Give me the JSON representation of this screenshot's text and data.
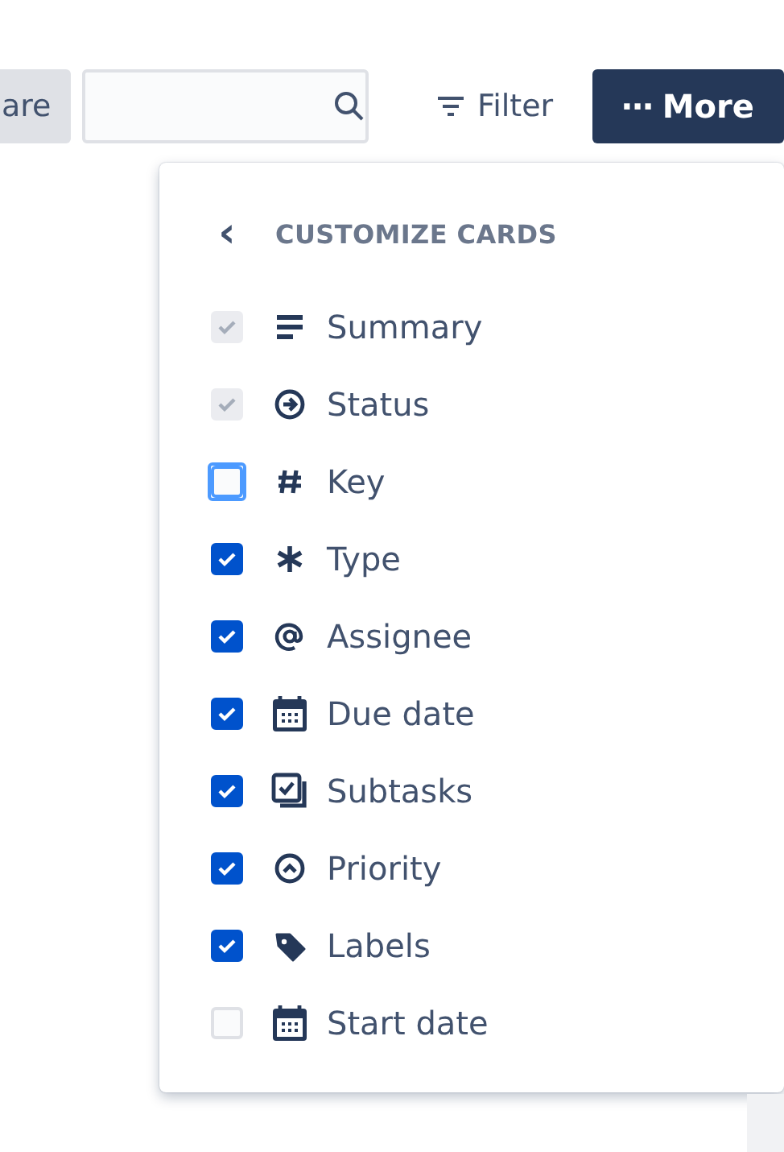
{
  "toolbar": {
    "share_button": "are",
    "filter_button": "Filter",
    "more_button": {
      "icon_text": "···",
      "label": "More"
    }
  },
  "dropdown": {
    "back": "‹",
    "title": "CUSTOMIZE CARDS",
    "items": [
      {
        "label": "Summary",
        "checked": true,
        "disabled": true,
        "focused": false
      },
      {
        "label": "Status",
        "checked": true,
        "disabled": true,
        "focused": false
      },
      {
        "label": "Key",
        "checked": false,
        "disabled": false,
        "focused": true
      },
      {
        "label": "Type",
        "checked": true,
        "disabled": false,
        "focused": false
      },
      {
        "label": "Assignee",
        "checked": true,
        "disabled": false,
        "focused": false
      },
      {
        "label": "Due date",
        "checked": true,
        "disabled": false,
        "focused": false
      },
      {
        "label": "Subtasks",
        "checked": true,
        "disabled": false,
        "focused": false
      },
      {
        "label": "Priority",
        "checked": true,
        "disabled": false,
        "focused": false
      },
      {
        "label": "Labels",
        "checked": true,
        "disabled": false,
        "focused": false
      },
      {
        "label": "Start date",
        "checked": false,
        "disabled": false,
        "focused": false
      }
    ]
  }
}
